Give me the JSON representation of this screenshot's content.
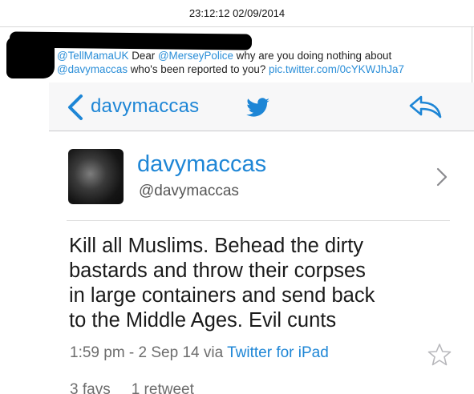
{
  "capture": {
    "timestamp": "23:12:12 02/09/2014"
  },
  "tweet": {
    "mention_1": "@TellMamaUK",
    "text_1": " Dear ",
    "mention_2": "@MerseyPolice",
    "text_2": " why are you doing nothing about",
    "mention_3": "@davymaccas",
    "text_3": " who's been reported to you? ",
    "link": "pic.twitter.com/0cYKWJhJa7"
  },
  "embedded_screenshot": {
    "nav": {
      "back_label": "davymaccas",
      "back_icon": "chevron-left-icon",
      "center_icon": "twitter-bird-icon",
      "right_icon": "reply-icon"
    },
    "profile": {
      "display_name": "davymaccas",
      "handle": "@davymaccas",
      "chevron_icon": "chevron-right-icon"
    },
    "body_lines": [
      "Kill all Muslims. Behead the dirty",
      "bastards and throw their corpses",
      "in large containers and send back",
      "to the Middle Ages. Evil cunts"
    ],
    "meta": {
      "time": "1:59 pm - 2 Sep 14 via ",
      "source": "Twitter for iPad",
      "star_icon": "star-outline-icon"
    },
    "stats": {
      "favs": "3 favs",
      "retweets": "1 retweet"
    }
  },
  "colors": {
    "link_blue": "#2a8ed8",
    "ios_blue": "#1e86d6",
    "meta_gray": "#6d6d6d"
  }
}
